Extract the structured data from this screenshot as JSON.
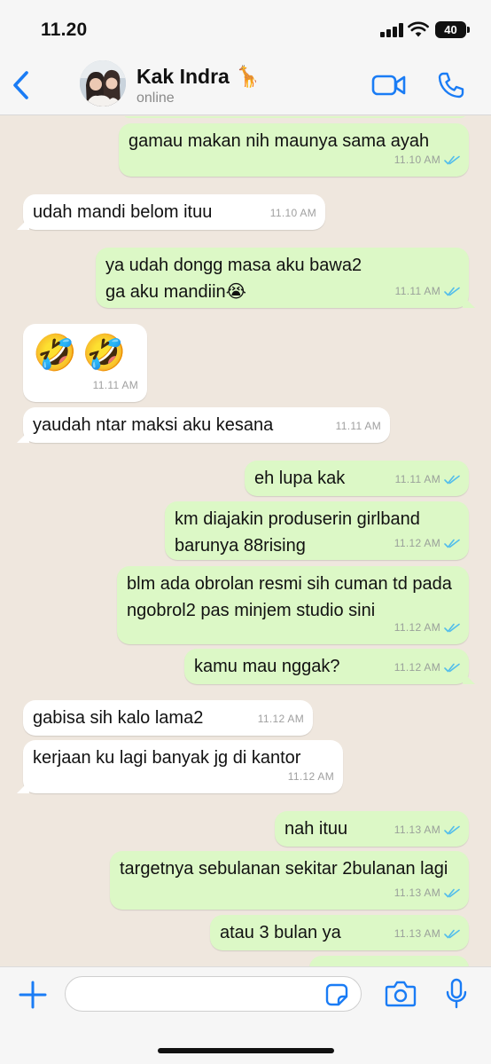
{
  "status_bar": {
    "time": "11.20",
    "battery": "40"
  },
  "header": {
    "contact_name": "Kak Indra 🦒",
    "status": "online"
  },
  "messages": [
    {
      "dir": "out",
      "text": "gamau makan nih maunya sama ayah",
      "time": "11.10 AM"
    },
    {
      "dir": "in",
      "text": "udah mandi belom ituu",
      "time": "11.10 AM"
    },
    {
      "dir": "out",
      "text": "ya udah dongg masa aku bawa2 ga aku mandiin😭",
      "time": "11.11 AM"
    },
    {
      "dir": "in",
      "text": "🤣🤣",
      "time": "11.11 AM"
    },
    {
      "dir": "in",
      "text": "yaudah ntar maksi aku kesana",
      "time": "11.11 AM"
    },
    {
      "dir": "out",
      "text": "eh lupa kak",
      "time": "11.11 AM"
    },
    {
      "dir": "out",
      "text": "km diajakin produserin girlband barunya 88rising",
      "time": "11.12 AM"
    },
    {
      "dir": "out",
      "text": "blm ada obrolan resmi sih cuman td pada ngobrol2 pas minjem studio sini",
      "time": "11.12 AM"
    },
    {
      "dir": "out",
      "text": "kamu mau nggak?",
      "time": "11.12 AM"
    },
    {
      "dir": "in",
      "text": "gabisa sih kalo lama2",
      "time": "11.12 AM"
    },
    {
      "dir": "in",
      "text": "kerjaan ku lagi banyak jg di kantor",
      "time": "11.12 AM"
    },
    {
      "dir": "out",
      "text": "nah ituu",
      "time": "11.13 AM"
    },
    {
      "dir": "out",
      "text": "targetnya sebulanan sekitar 2bulanan lagi",
      "time": "11.13 AM"
    },
    {
      "dir": "out",
      "text": "atau 3 bulan ya",
      "time": "11.13 AM"
    }
  ],
  "input": {
    "value": ""
  },
  "colors": {
    "accent": "#1a7cf5",
    "outgoing_bubble": "#dcf8c6",
    "incoming_bubble": "#ffffff",
    "read_ticks": "#53bdeb"
  },
  "icons": [
    "back-chevron-icon",
    "video-call-icon",
    "phone-icon",
    "plus-icon",
    "sticker-icon",
    "camera-icon",
    "microphone-icon"
  ]
}
